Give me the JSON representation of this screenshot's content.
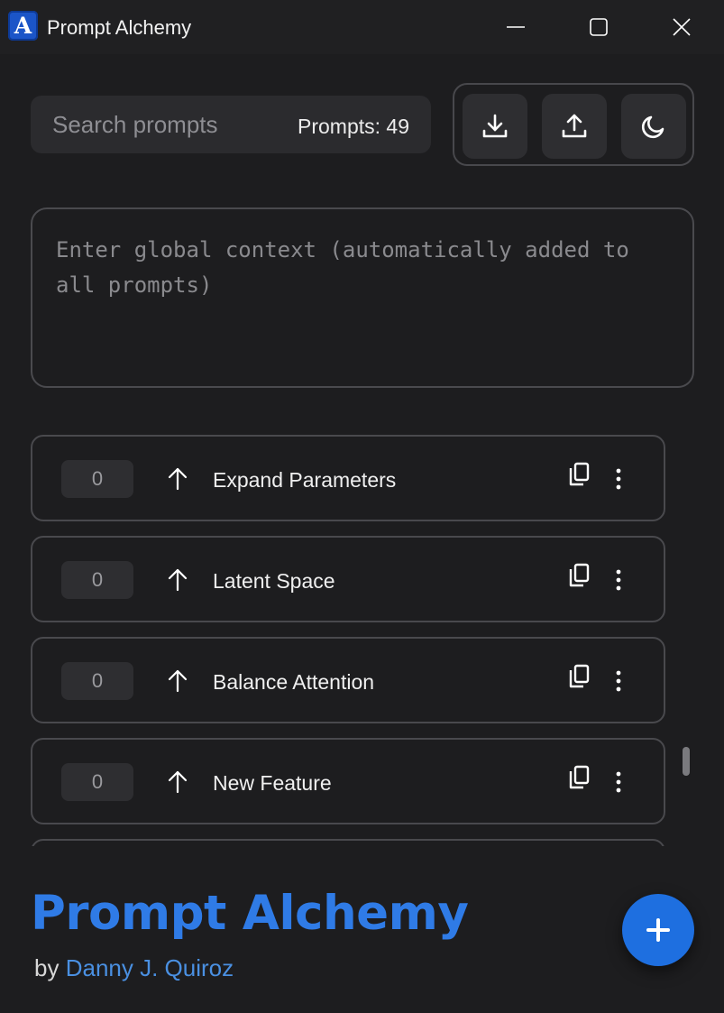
{
  "window": {
    "title": "Prompt Alchemy",
    "logo_letter": "A",
    "controls": {
      "minimize": "minimize-icon",
      "maximize": "maximize-icon",
      "close": "close-icon"
    }
  },
  "toolbar": {
    "search_placeholder": "Search prompts",
    "search_value": "",
    "prompt_count": "Prompts: 49",
    "buttons": [
      "download-icon",
      "upload-icon",
      "moon-icon"
    ]
  },
  "global_context": {
    "placeholder": "Enter global context (automatically added to all prompts)",
    "value": ""
  },
  "prompts": [
    {
      "count": "0",
      "title": "Expand Parameters"
    },
    {
      "count": "0",
      "title": "Latent Space"
    },
    {
      "count": "0",
      "title": "Balance Attention"
    },
    {
      "count": "0",
      "title": "New Feature"
    }
  ],
  "footer": {
    "brand": "Prompt Alchemy",
    "by": "by",
    "author": "Danny J. Quiroz"
  },
  "colors": {
    "background": "#1d1d1f",
    "accent": "#2f7be6",
    "fab": "#1e6fe0",
    "author_link": "#4a90e2"
  }
}
